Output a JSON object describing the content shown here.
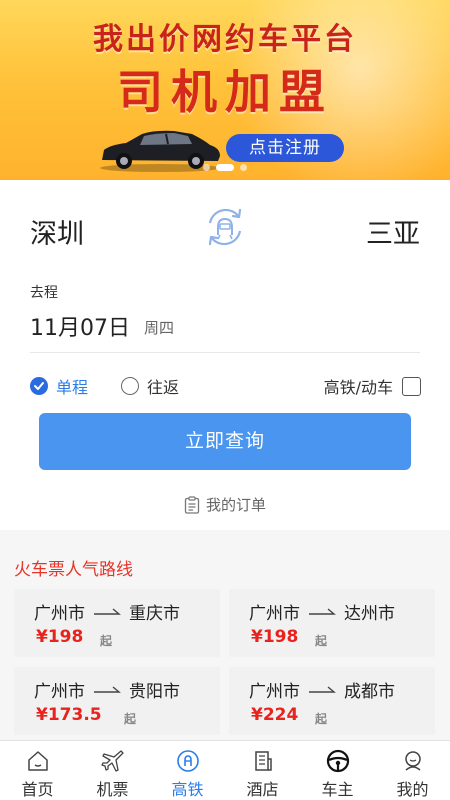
{
  "banner": {
    "headline": "我出价网约车平台",
    "title": "司机加盟",
    "cta": "点击注册"
  },
  "search": {
    "from_city": "深圳",
    "to_city": "三亚",
    "departure_label": "去程",
    "departure_date": "11月07日",
    "departure_weekday": "周四",
    "trip_options": [
      {
        "label": "单程",
        "selected": true
      },
      {
        "label": "往返",
        "selected": false
      }
    ],
    "hsr_label": "高铁/动车",
    "hsr_checked": false,
    "search_button": "立即查询",
    "my_orders": "我的订单"
  },
  "popular": {
    "title": "火车票人气路线",
    "routes": [
      {
        "from": "广州市",
        "to": "重庆市",
        "price": "¥198",
        "suffix": "起"
      },
      {
        "from": "广州市",
        "to": "达州市",
        "price": "¥198",
        "suffix": "起"
      },
      {
        "from": "广州市",
        "to": "贵阳市",
        "price": "¥173.5",
        "suffix": "起"
      },
      {
        "from": "广州市",
        "to": "成都市",
        "price": "¥224",
        "suffix": "起"
      }
    ]
  },
  "nav": {
    "items": [
      {
        "label": "首页",
        "icon": "home-icon"
      },
      {
        "label": "机票",
        "icon": "plane-icon"
      },
      {
        "label": "高铁",
        "icon": "train-icon",
        "active": true
      },
      {
        "label": "酒店",
        "icon": "hotel-icon"
      },
      {
        "label": "车主",
        "icon": "steering-wheel-icon"
      },
      {
        "label": "我的",
        "icon": "profile-icon"
      }
    ]
  },
  "colors": {
    "accent": "#2b7de9",
    "search_button": "#4a95ef",
    "price": "#e8221c",
    "section_title": "#e8352a",
    "banner_red": "#d52a1a"
  }
}
